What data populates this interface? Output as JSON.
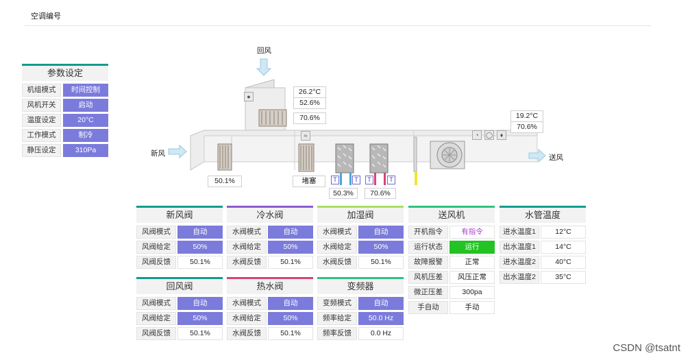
{
  "header": {
    "title": "空调编号"
  },
  "watermark": "CSDN @tsatnt",
  "params": {
    "title": "参数设定",
    "rows": [
      {
        "label": "机组模式",
        "value": "时间控制"
      },
      {
        "label": "风机开关",
        "value": "启动"
      },
      {
        "label": "温度设定",
        "value": "20°C"
      },
      {
        "label": "工作模式",
        "value": "制冷"
      },
      {
        "label": "静压设定",
        "value": "310Pa"
      }
    ]
  },
  "diagram": {
    "return_air": "回风",
    "fresh_air": "新风",
    "supply_air": "送风",
    "return_temp": "26.2°C",
    "return_hum": "52.6%",
    "mid_hum": "70.6%",
    "supply_temp": "19.2°C",
    "supply_hum": "70.6%",
    "damper_open": "50.1%",
    "filter_state": "堵塞",
    "cold_valve": "50.3%",
    "hot_valve": "70.6%",
    "t_marker": "T"
  },
  "cards": {
    "fresh_valve": {
      "title": "新风阀",
      "color": "#119c8c",
      "rows": [
        {
          "label": "风阀模式",
          "value": "自动"
        },
        {
          "label": "风阀给定",
          "value": "50%"
        },
        {
          "label": "风阀反馈",
          "value": "50.1%"
        }
      ]
    },
    "cold_valve": {
      "title": "冷水阀",
      "color": "#8a5cd0",
      "rows": [
        {
          "label": "水阀模式",
          "value": "自动"
        },
        {
          "label": "水阀给定",
          "value": "50%"
        },
        {
          "label": "水阀反馈",
          "value": "50.1%"
        }
      ]
    },
    "humid_valve": {
      "title": "加湿阀",
      "color": "#a8e060",
      "rows": [
        {
          "label": "水阀模式",
          "value": "自动"
        },
        {
          "label": "水阀给定",
          "value": "50%"
        },
        {
          "label": "水阀反馈",
          "value": "50.1%"
        }
      ]
    },
    "fan": {
      "title": "送风机",
      "color": "#2ec27e",
      "rows": [
        {
          "label": "开机指令",
          "value": "有指令"
        },
        {
          "label": "运行状态",
          "value": "运行"
        },
        {
          "label": "故障报警",
          "value": "正常"
        },
        {
          "label": "风机压差",
          "value": "风压正常"
        },
        {
          "label": "微正压差",
          "value": "300pa"
        },
        {
          "label": "手自动",
          "value": "手动"
        }
      ]
    },
    "water_temp": {
      "title": "水管温度",
      "color": "#119c8c",
      "rows": [
        {
          "label": "进水温度1",
          "value": "12°C"
        },
        {
          "label": "出水温度1",
          "value": "14°C"
        },
        {
          "label": "进水温度2",
          "value": "40°C"
        },
        {
          "label": "出水温度2",
          "value": "35°C"
        }
      ]
    },
    "return_valve": {
      "title": "回风阀",
      "color": "#119c8c",
      "rows": [
        {
          "label": "风阀模式",
          "value": "自动"
        },
        {
          "label": "风阀给定",
          "value": "50%"
        },
        {
          "label": "风阀反馈",
          "value": "50.1%"
        }
      ]
    },
    "hot_valve": {
      "title": "热水阀",
      "color": "#d9437a",
      "rows": [
        {
          "label": "水阀模式",
          "value": "自动"
        },
        {
          "label": "水阀给定",
          "value": "50%"
        },
        {
          "label": "水阀反馈",
          "value": "50.1%"
        }
      ]
    },
    "vfd": {
      "title": "变频器",
      "color": "#2ec27e",
      "rows": [
        {
          "label": "变频模式",
          "value": "自动"
        },
        {
          "label": "频率给定",
          "value": "50.0 Hz"
        },
        {
          "label": "频率反馈",
          "value": "0.0 Hz"
        }
      ]
    }
  }
}
